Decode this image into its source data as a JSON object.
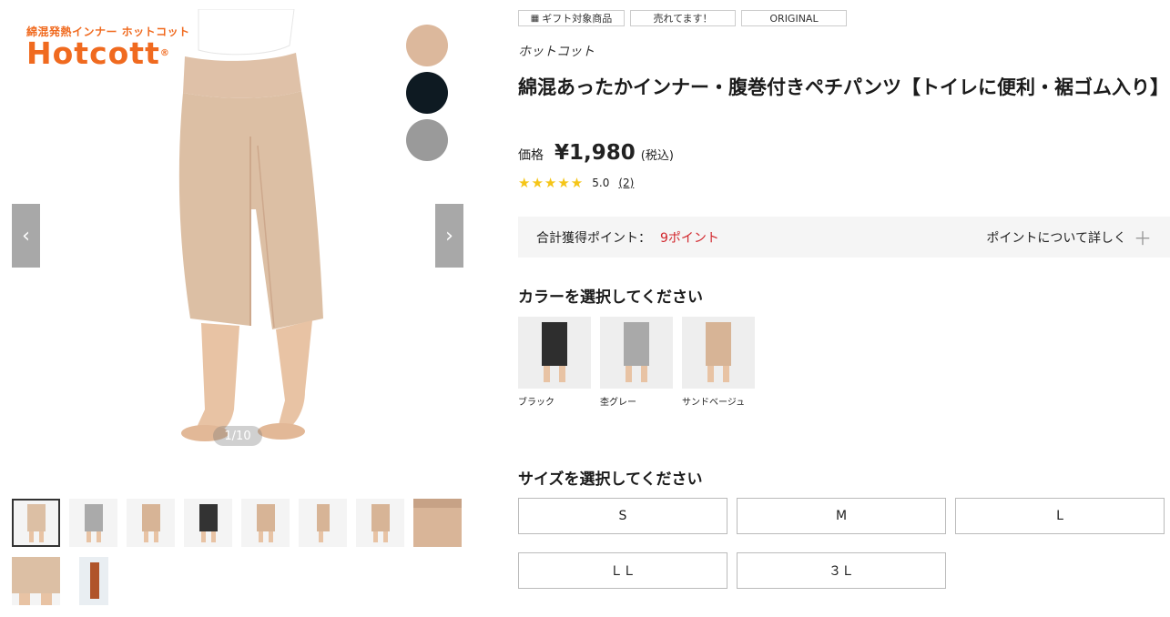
{
  "gallery": {
    "brand_sub": "綿混発熱インナー ホットコット",
    "brand_name": "Hotcott",
    "brand_reg": "®",
    "prev_label": "‹",
    "next_label": "›",
    "counter": "1/10",
    "swatch_colors": [
      "#dcb89c",
      "#0e1a22",
      "#9a9a9a"
    ]
  },
  "badges": [
    "ギフト対象商品",
    "売れてます！",
    "ORIGINAL"
  ],
  "product": {
    "brand": "ホットコット",
    "title": "綿混あったかインナー・腹巻付きペチパンツ【トイレに便利・裾ゴム入り】",
    "price_label": "価格",
    "price": "¥1,980",
    "tax": "(税込)",
    "stars": "★★★★★",
    "rating": "5.0",
    "review_count": "(2)"
  },
  "points": {
    "label": "合計獲得ポイント：",
    "value": "9ポイント",
    "link": "ポイントについて詳しく"
  },
  "color_section": {
    "title": "カラーを選択してください",
    "options": [
      {
        "name": "ブラック",
        "color": "#2e2e2e"
      },
      {
        "name": "杢グレー",
        "color": "#a9a9a9"
      },
      {
        "name": "サンドベージュ",
        "color": "#d7b496"
      }
    ]
  },
  "size_section": {
    "title": "サイズを選択してください",
    "sizes": [
      "S",
      "M",
      "L",
      "ＬＬ",
      "３Ｌ"
    ]
  },
  "colors": {
    "accent_red": "#d2262c",
    "brand_orange": "#f06a1f",
    "skin": "#dcb89c",
    "pants_beige": "#dcbfa4"
  }
}
